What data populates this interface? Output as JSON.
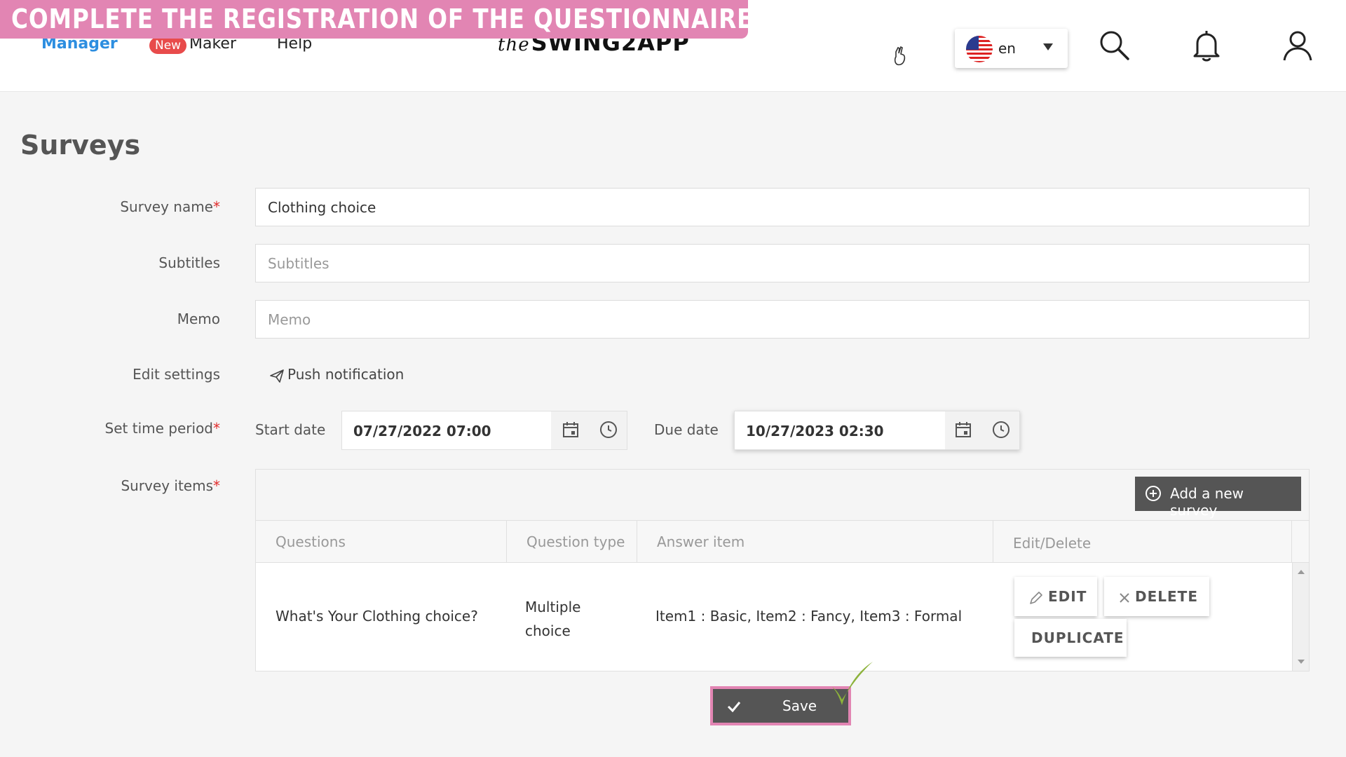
{
  "banner": {
    "text": "COMPLETE THE REGISTRATION OF THE QUESTIONNAIRE",
    "color": "#e285b3"
  },
  "nav": {
    "manager": "Manager",
    "new_badge": "New",
    "maker": "Maker",
    "help": "Help",
    "active_color": "#2d8ee0"
  },
  "logo": {
    "script": "the",
    "text": "SWING2APP"
  },
  "language": {
    "code": "en",
    "flag": "us-flag-icon"
  },
  "page": {
    "title": "Surveys"
  },
  "form": {
    "survey_name_label": "Survey name",
    "survey_name_value": "Clothing choice",
    "subtitles_label": "Subtitles",
    "subtitles_placeholder": "Subtitles",
    "memo_label": "Memo",
    "memo_placeholder": "Memo",
    "edit_settings_label": "Edit settings",
    "push_notification": "Push notification",
    "time_period_label": "Set time period",
    "start_date_label": "Start date",
    "start_date_value": "07/27/2022 07:00",
    "due_date_label": "Due date",
    "due_date_value": "10/27/2023 02:30",
    "survey_items_label": "Survey items",
    "required_mark": "*"
  },
  "survey_table": {
    "add_button": "Add a new survey",
    "columns": [
      "Questions",
      "Question type",
      "Answer item",
      "Edit/Delete"
    ],
    "rows": [
      {
        "question": "What's Your Clothing choice?",
        "type_line1": "Multiple",
        "type_line2": "choice",
        "answer": "Item1 : Basic, Item2 : Fancy, Item3 : Formal",
        "edit": "EDIT",
        "delete": "DELETE",
        "duplicate": "DUPLICATE"
      }
    ]
  },
  "save": {
    "label": "Save"
  }
}
